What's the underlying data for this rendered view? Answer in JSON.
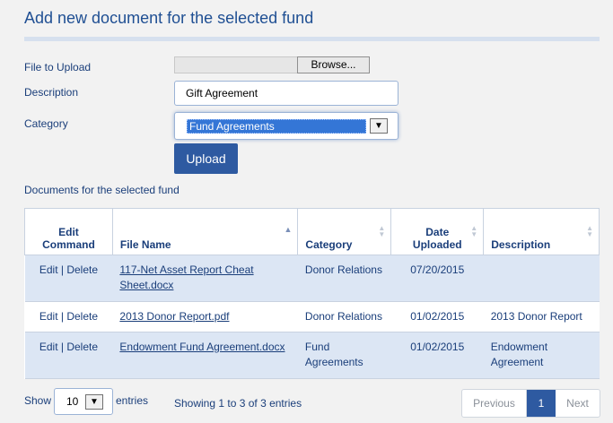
{
  "page": {
    "title": "Add new document for the selected fund"
  },
  "form": {
    "file_label": "File to Upload",
    "browse_label": "Browse...",
    "description_label": "Description",
    "description_value": "Gift Agreement",
    "category_label": "Category",
    "category_value": "Fund Agreements",
    "upload_label": "Upload"
  },
  "docs_label": "Documents for the selected fund",
  "table": {
    "headers": {
      "edit_command": [
        "Edit",
        "Command"
      ],
      "file_name": "File Name",
      "category": "Category",
      "date_uploaded": [
        "Date",
        "Uploaded"
      ],
      "description": "Description"
    },
    "rows": [
      {
        "edit": "Edit",
        "delete": "Delete",
        "file_name": "117-Net Asset Report Cheat Sheet.docx",
        "category": "Donor Relations",
        "date": "07/20/2015",
        "description": ""
      },
      {
        "edit": "Edit",
        "delete": "Delete",
        "file_name": "2013 Donor Report.pdf",
        "category": "Donor Relations",
        "date": "01/02/2015",
        "description": "2013 Donor Report"
      },
      {
        "edit": "Edit",
        "delete": "Delete",
        "file_name": "Endowment Fund Agreement.docx",
        "category": "Fund Agreements",
        "date": "01/02/2015",
        "description": "Endowment Agreement"
      }
    ]
  },
  "footer": {
    "show_label": "Show",
    "page_length": "10",
    "entries_label": "entries",
    "info": "Showing 1 to 3 of 3 entries",
    "previous": "Previous",
    "current_page": "1",
    "next": "Next"
  }
}
